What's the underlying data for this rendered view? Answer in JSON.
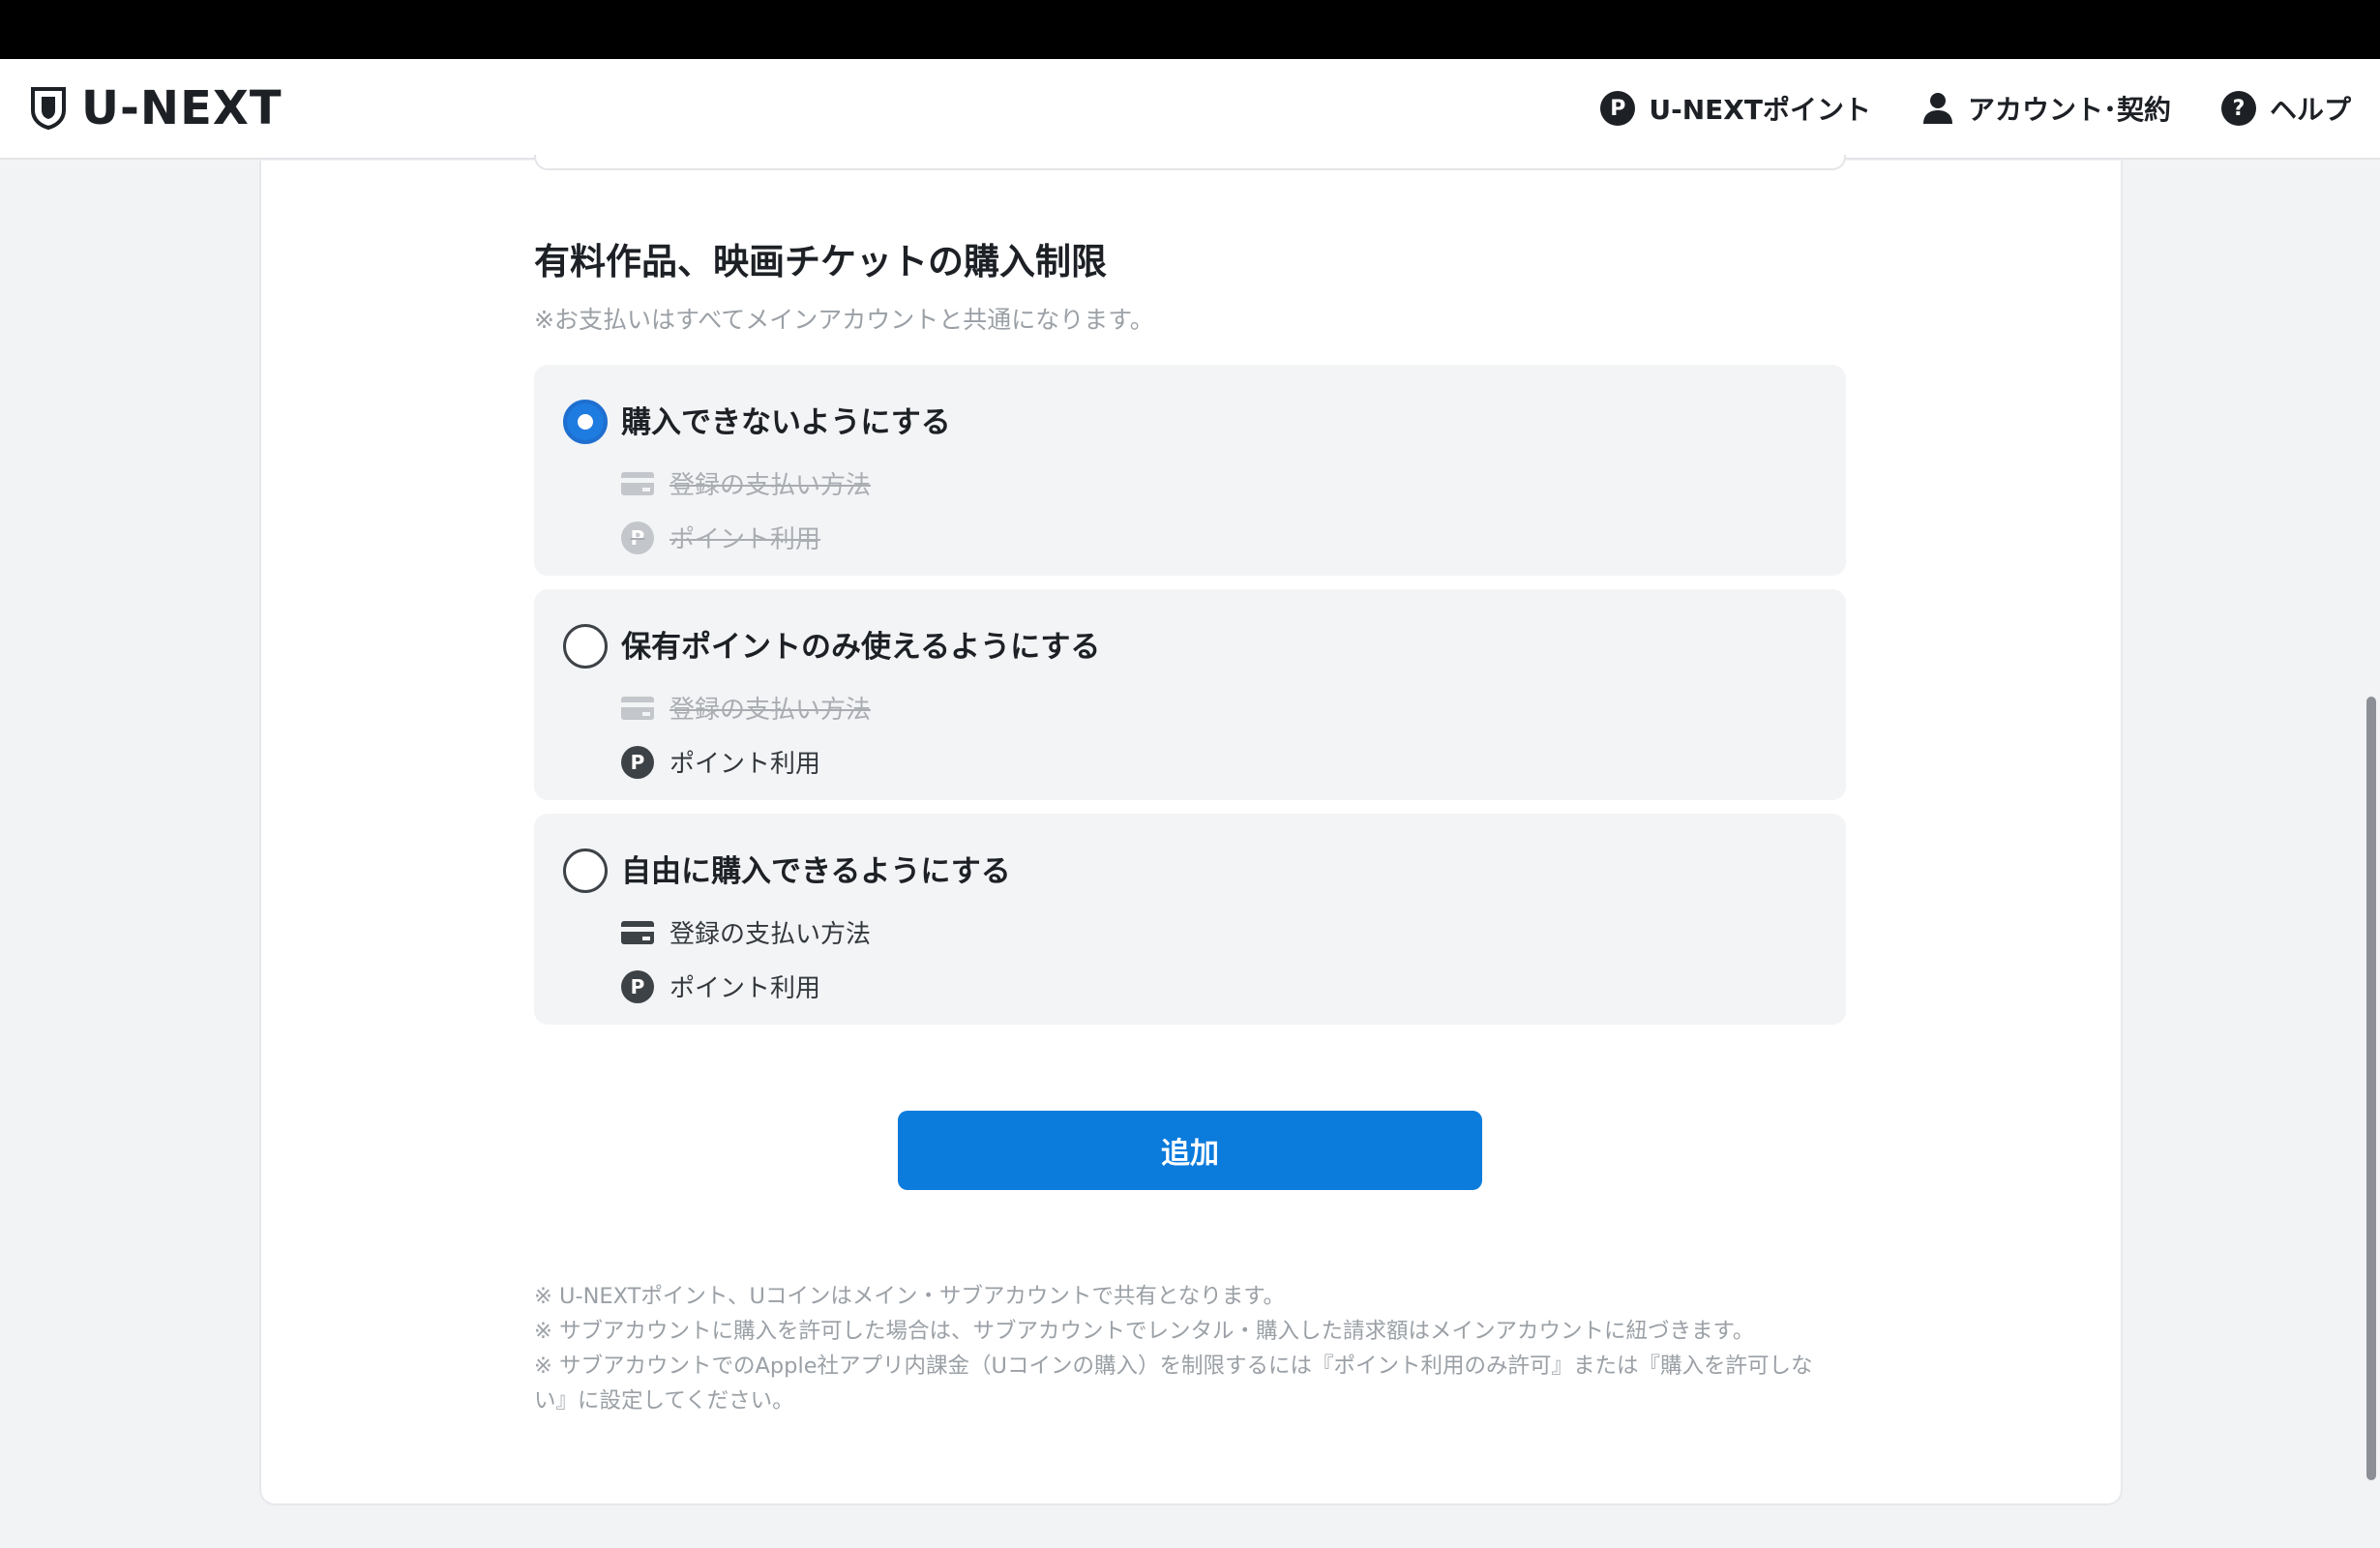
{
  "header": {
    "logo_text": "U-NEXT",
    "nav": [
      {
        "icon": "point-icon",
        "icon_glyph": "P",
        "label": "U-NEXTポイント"
      },
      {
        "icon": "user-icon",
        "label": "アカウント･契約"
      },
      {
        "icon": "help-icon",
        "icon_glyph": "?",
        "label": "ヘルプ"
      }
    ]
  },
  "section": {
    "title": "有料作品、映画チケットの購入制限",
    "note": "※お支払いはすべてメインアカウントと共通になります。"
  },
  "options": [
    {
      "label": "購入できないようにする",
      "selected": true,
      "payment": {
        "label": "登録の支払い方法",
        "enabled": false
      },
      "points": {
        "label": "ポイント利用",
        "enabled": false
      }
    },
    {
      "label": "保有ポイントのみ使えるようにする",
      "selected": false,
      "payment": {
        "label": "登録の支払い方法",
        "enabled": false
      },
      "points": {
        "label": "ポイント利用",
        "enabled": true
      }
    },
    {
      "label": "自由に購入できるようにする",
      "selected": false,
      "payment": {
        "label": "登録の支払い方法",
        "enabled": true
      },
      "points": {
        "label": "ポイント利用",
        "enabled": true
      }
    }
  ],
  "point_glyph": "P",
  "add_button_label": "追加",
  "footnotes": [
    "※ U-NEXTポイント、Uコインはメイン・サブアカウントで共有となります。",
    "※ サブアカウントに購入を許可した場合は、サブアカウントでレンタル・購入した請求額はメインアカウントに紐づきます。",
    "※ サブアカウントでのApple社アプリ内課金（Uコインの購入）を制限するには『ポイント利用のみ許可』または『購入を許可しない』に設定してください。"
  ],
  "colors": {
    "accent": "#0b7bdc",
    "selected_radio": "#1e7be0",
    "option_bg": "#f3f4f6",
    "muted_text": "#9aa0a6"
  }
}
